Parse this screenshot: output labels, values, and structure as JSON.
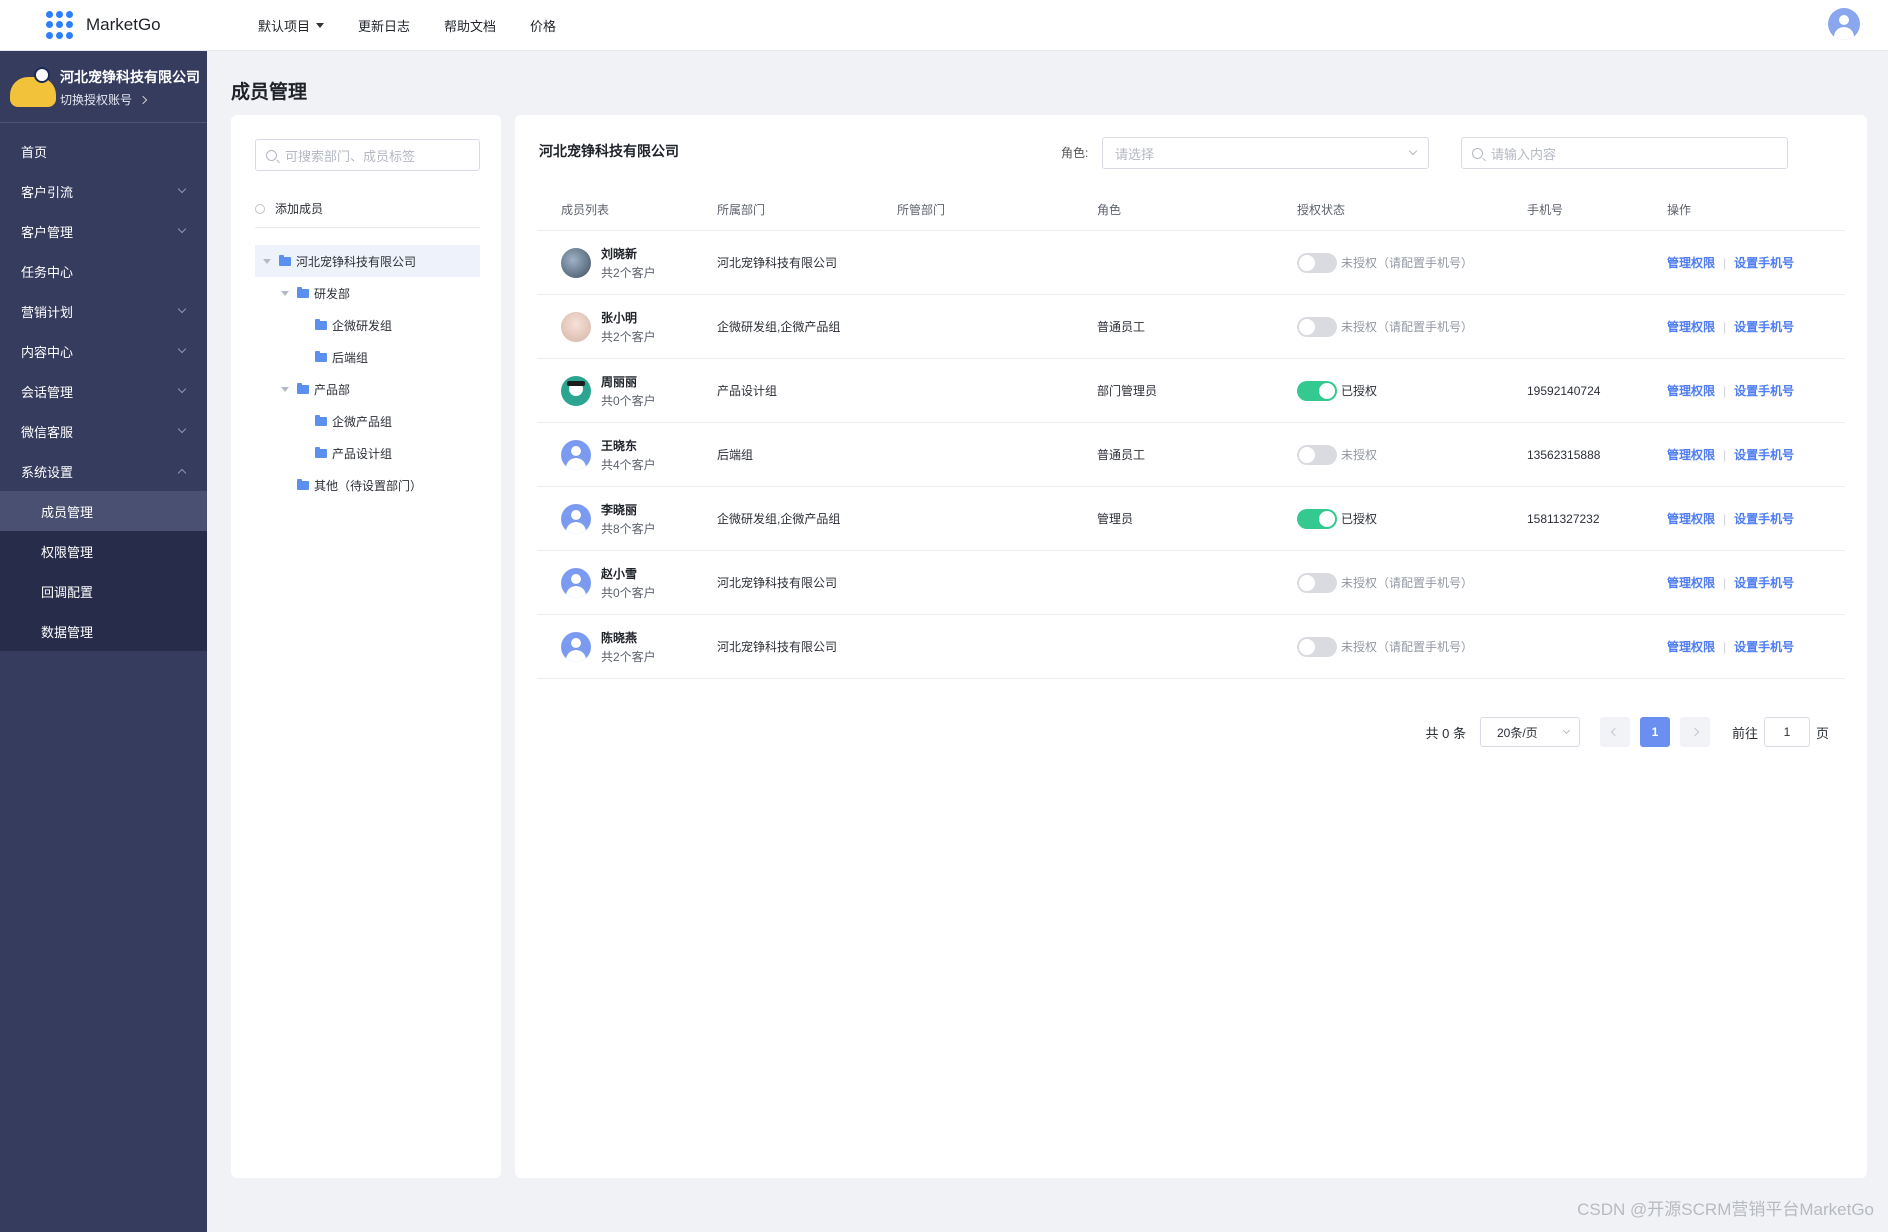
{
  "app": {
    "name": "MarketGo"
  },
  "topnav": {
    "items": [
      {
        "label": "默认项目"
      },
      {
        "label": "更新日志"
      },
      {
        "label": "帮助文档"
      },
      {
        "label": "价格"
      }
    ]
  },
  "sidebar": {
    "org_name": "河北宠铮科技有限公司",
    "switch_label": "切换授权账号",
    "items": [
      {
        "label": "首页"
      },
      {
        "label": "客户引流"
      },
      {
        "label": "客户管理"
      },
      {
        "label": "任务中心"
      },
      {
        "label": "营销计划"
      },
      {
        "label": "内容中心"
      },
      {
        "label": "会话管理"
      },
      {
        "label": "微信客服"
      },
      {
        "label": "系统设置"
      }
    ],
    "sub_items": [
      {
        "label": "成员管理"
      },
      {
        "label": "权限管理"
      },
      {
        "label": "回调配置"
      },
      {
        "label": "数据管理"
      }
    ]
  },
  "page": {
    "title": "成员管理"
  },
  "tree_panel": {
    "search_placeholder": "可搜索部门、成员标签",
    "add_member": "添加成员",
    "nodes": [
      {
        "label": "河北宠铮科技有限公司"
      },
      {
        "label": "研发部"
      },
      {
        "label": "企微研发组"
      },
      {
        "label": "后端组"
      },
      {
        "label": "产品部"
      },
      {
        "label": "企微产品组"
      },
      {
        "label": "产品设计组"
      },
      {
        "label": "其他（待设置部门）"
      }
    ]
  },
  "main_panel": {
    "org_name": "河北宠铮科技有限公司",
    "role_label": "角色:",
    "role_placeholder": "请选择",
    "search_placeholder": "请输入内容"
  },
  "table": {
    "headers": [
      "成员列表",
      "所属部门",
      "所管部门",
      "角色",
      "授权状态",
      "手机号",
      "操作"
    ],
    "op_manage": "管理权限",
    "op_phone": "设置手机号",
    "rows": [
      {
        "name": "刘晓新",
        "count": "共2个客户",
        "dept": "河北宠铮科技有限公司",
        "managed": "",
        "role": "",
        "authorized": false,
        "status": "未授权（请配置手机号）",
        "phone": "",
        "avatar": "photo-a"
      },
      {
        "name": "张小明",
        "count": "共2个客户",
        "dept": "企微研发组,企微产品组",
        "managed": "",
        "role": "普通员工",
        "authorized": false,
        "status": "未授权（请配置手机号）",
        "phone": "",
        "avatar": "photo-b"
      },
      {
        "name": "周丽丽",
        "count": "共0个客户",
        "dept": "产品设计组",
        "managed": "",
        "role": "部门管理员",
        "authorized": true,
        "status": "已授权",
        "phone": "19592140724",
        "avatar": "photo-c"
      },
      {
        "name": "王晓东",
        "count": "共4个客户",
        "dept": "后端组",
        "managed": "",
        "role": "普通员工",
        "authorized": false,
        "status": "未授权",
        "phone": "13562315888",
        "avatar": "default"
      },
      {
        "name": "李晓丽",
        "count": "共8个客户",
        "dept": "企微研发组,企微产品组",
        "managed": "",
        "role": "管理员",
        "authorized": true,
        "status": "已授权",
        "phone": "15811327232",
        "avatar": "default"
      },
      {
        "name": "赵小雪",
        "count": "共0个客户",
        "dept": "河北宠铮科技有限公司",
        "managed": "",
        "role": "",
        "authorized": false,
        "status": "未授权（请配置手机号）",
        "phone": "",
        "avatar": "default"
      },
      {
        "name": "陈晓燕",
        "count": "共2个客户",
        "dept": "河北宠铮科技有限公司",
        "managed": "",
        "role": "",
        "authorized": false,
        "status": "未授权（请配置手机号）",
        "phone": "",
        "avatar": "default"
      }
    ]
  },
  "pagination": {
    "total": "共 0 条",
    "page_size": "20条/页",
    "current": "1",
    "goto_prefix": "前往",
    "goto_value": "1",
    "goto_suffix": "页"
  },
  "watermark": "CSDN @开源SCRM营销平台MarketGo",
  "colors": {
    "sidebar": "#363c5e",
    "accent": "#4e7cf2",
    "toggle_on": "#33c98f"
  }
}
